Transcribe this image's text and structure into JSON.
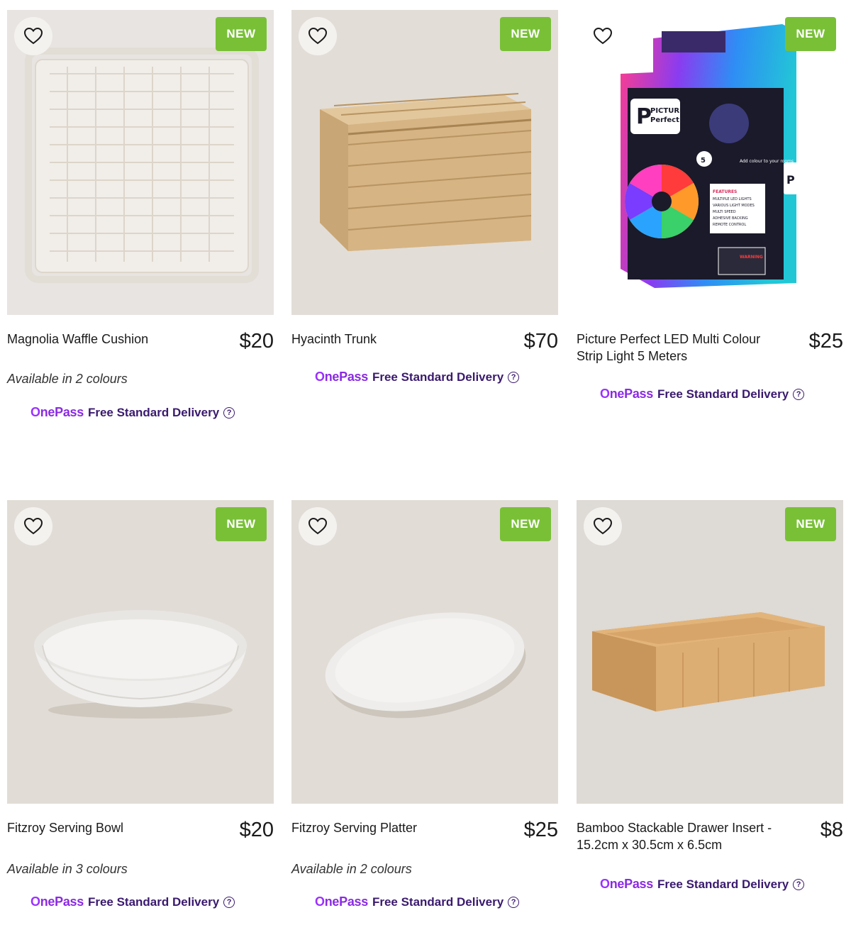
{
  "products": [
    {
      "name": "Magnolia Waffle Cushion",
      "price": "$20",
      "badge": "NEW",
      "colours": "Available in 2 colours",
      "image_icon": "cushion-image"
    },
    {
      "name": "Hyacinth Trunk",
      "price": "$70",
      "badge": "NEW",
      "colours": "",
      "image_icon": "trunk-image"
    },
    {
      "name": "Picture Perfect LED Multi Colour Strip Light 5 Meters",
      "price": "$25",
      "badge": "NEW",
      "colours": "",
      "image_icon": "led-box-image",
      "package": {
        "brand_line1": "PICTURE",
        "brand_line2": "Perfect",
        "brand_letter": "P",
        "add_colour": "Add colour to your rooms",
        "features_title": "FEATURES",
        "features": [
          "MULTIPLE LED LIGHTS",
          "VARIOUS LIGHT MODES",
          "MULTI SPEED",
          "ADHESIVE BACKING",
          "REMOTE CONTROL"
        ],
        "warning": "WARNING",
        "meters": "5"
      }
    },
    {
      "name": "Fitzroy Serving Bowl",
      "price": "$20",
      "badge": "NEW",
      "colours": "Available in 3 colours",
      "image_icon": "bowl-image"
    },
    {
      "name": "Fitzroy Serving Platter",
      "price": "$25",
      "badge": "NEW",
      "colours": "Available in 2 colours",
      "image_icon": "platter-image"
    },
    {
      "name": "Bamboo Stackable Drawer Insert - 15.2cm x 30.5cm x 6.5cm",
      "price": "$8",
      "badge": "NEW",
      "colours": "",
      "image_icon": "drawer-insert-image"
    }
  ],
  "onepass": {
    "logo_first": "O",
    "logo_rest": "nePass",
    "delivery_label": "Free Standard Delivery",
    "help_glyph": "?"
  },
  "colors": {
    "badge_green": "#79c037",
    "onepass_purple": "#8a2be2",
    "delivery_text": "#3a1a6e"
  }
}
